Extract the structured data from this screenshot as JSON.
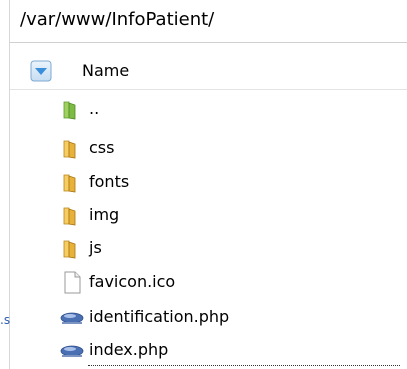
{
  "path_bar": {
    "path": "/var/www/InfoPatient/"
  },
  "columns": {
    "name_label": "Name"
  },
  "left_pane": {
    "fragment": ".s"
  },
  "files": [
    {
      "name": "..",
      "kind": "parent-folder",
      "icon": "green-folder-icon"
    },
    {
      "name": "css",
      "kind": "folder",
      "icon": "folder-icon"
    },
    {
      "name": "fonts",
      "kind": "folder",
      "icon": "folder-icon"
    },
    {
      "name": "img",
      "kind": "folder",
      "icon": "folder-icon"
    },
    {
      "name": "js",
      "kind": "folder",
      "icon": "folder-icon"
    },
    {
      "name": "favicon.ico",
      "kind": "file",
      "icon": "generic-file-icon"
    },
    {
      "name": "identification.php",
      "kind": "php",
      "icon": "php-file-icon"
    },
    {
      "name": "index.php",
      "kind": "php",
      "icon": "php-file-icon"
    }
  ],
  "colors": {
    "folder": "#e8b23a",
    "parent_folder": "#7dbb45",
    "sort_button": "#3b8ed9",
    "php_icon": "#4a6fb3",
    "link_text": "#2a5db0"
  }
}
